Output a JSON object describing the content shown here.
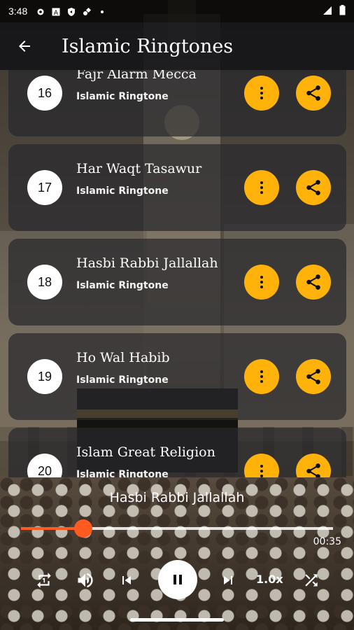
{
  "status_bar": {
    "time": "3:48",
    "icons": [
      "gear-icon",
      "a-box-icon",
      "shield-icon",
      "satellite-icon",
      "dot-icon"
    ],
    "right_icons": [
      "signal-icon",
      "battery-icon"
    ]
  },
  "app_bar": {
    "title": "Islamic Ringtones",
    "back_icon": "arrow-left-icon"
  },
  "list": {
    "items": [
      {
        "number": "16",
        "title": "Fajr Alarm Mecca",
        "subtitle": "Islamic Ringtone"
      },
      {
        "number": "17",
        "title": "Har Waqt Tasawur",
        "subtitle": "Islamic Ringtone"
      },
      {
        "number": "18",
        "title": "Hasbi Rabbi Jallallah",
        "subtitle": "Islamic Ringtone"
      },
      {
        "number": "19",
        "title": "Ho Wal Habib",
        "subtitle": "Islamic Ringtone"
      },
      {
        "number": "20",
        "title": "Islam Great Religion",
        "subtitle": "Islamic Ringtone"
      }
    ],
    "more_icon": "more-vertical-icon",
    "share_icon": "share-icon",
    "accent_color": "#ffb20a"
  },
  "player": {
    "now_playing": "Hasbi Rabbi Jallallah",
    "elapsed": "00:35",
    "progress": 0.2,
    "speed": "1.0x",
    "seek_color": "#ff5a1f",
    "controls": [
      "repeat-one-icon",
      "volume-icon",
      "skip-previous-icon",
      "pause-icon",
      "skip-next-icon",
      "shuffle-icon"
    ]
  }
}
